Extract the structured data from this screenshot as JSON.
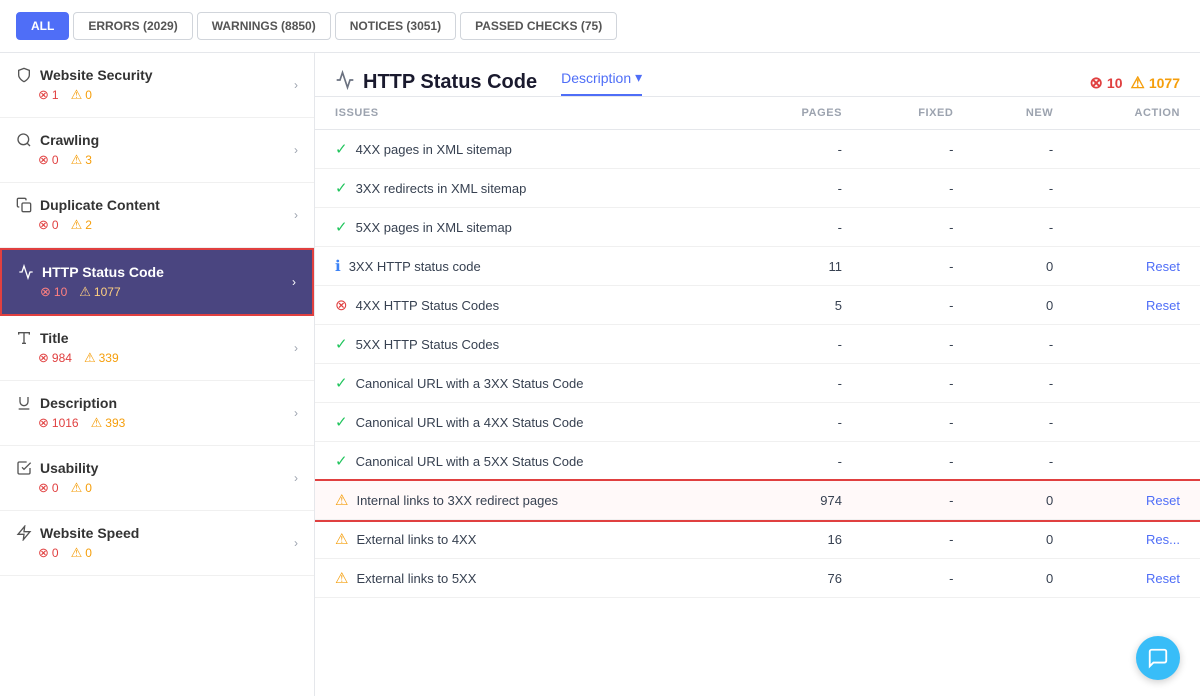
{
  "filterBar": {
    "buttons": [
      {
        "id": "all",
        "label": "ALL",
        "active": true
      },
      {
        "id": "errors",
        "label": "ERRORS (2029)",
        "active": false
      },
      {
        "id": "warnings",
        "label": "WARNINGS (8850)",
        "active": false
      },
      {
        "id": "notices",
        "label": "NOTICES (3051)",
        "active": false
      },
      {
        "id": "passed",
        "label": "PASSED CHECKS (75)",
        "active": false
      }
    ]
  },
  "sidebar": {
    "items": [
      {
        "id": "website-security",
        "icon": "shield",
        "label": "Website Security",
        "errorCount": 1,
        "warningCount": 0,
        "active": false
      },
      {
        "id": "crawling",
        "icon": "search",
        "label": "Crawling",
        "errorCount": 0,
        "warningCount": 3,
        "active": false
      },
      {
        "id": "duplicate-content",
        "icon": "copy",
        "label": "Duplicate Content",
        "errorCount": 0,
        "warningCount": 2,
        "active": false
      },
      {
        "id": "http-status-code",
        "icon": "activity",
        "label": "HTTP Status Code",
        "errorCount": 10,
        "warningCount": 1077,
        "active": true
      },
      {
        "id": "title",
        "icon": "text",
        "label": "Title",
        "errorCount": 984,
        "warningCount": 339,
        "active": false
      },
      {
        "id": "description",
        "icon": "underline",
        "label": "Description",
        "errorCount": 1016,
        "warningCount": 393,
        "active": false
      },
      {
        "id": "usability",
        "icon": "check-square",
        "label": "Usability",
        "errorCount": 0,
        "warningCount": 0,
        "active": false
      },
      {
        "id": "website-speed",
        "icon": "speed",
        "label": "Website Speed",
        "errorCount": 0,
        "warningCount": 0,
        "active": false
      }
    ]
  },
  "content": {
    "title": "HTTP Status Code",
    "descriptionButton": "Description",
    "errorCount": 10,
    "warningCount": 1077,
    "tableHeaders": {
      "issues": "ISSUES",
      "pages": "PAGES",
      "fixed": "FIXED",
      "new": "NEW",
      "action": "ACTION"
    },
    "rows": [
      {
        "id": "4xx-sitemap",
        "status": "check",
        "label": "4XX pages in XML sitemap",
        "pages": "-",
        "fixed": "-",
        "new": "-",
        "action": "",
        "highlighted": false
      },
      {
        "id": "3xx-sitemap",
        "status": "check",
        "label": "3XX redirects in XML sitemap",
        "pages": "-",
        "fixed": "-",
        "new": "-",
        "action": "",
        "highlighted": false
      },
      {
        "id": "5xx-sitemap",
        "status": "check",
        "label": "5XX pages in XML sitemap",
        "pages": "-",
        "fixed": "-",
        "new": "-",
        "action": "",
        "highlighted": false
      },
      {
        "id": "3xx-http",
        "status": "info",
        "label": "3XX HTTP status code",
        "pages": "11",
        "fixed": "-",
        "new": "0",
        "action": "Reset",
        "highlighted": false
      },
      {
        "id": "4xx-http",
        "status": "error",
        "label": "4XX HTTP Status Codes",
        "pages": "5",
        "fixed": "-",
        "new": "0",
        "action": "Reset",
        "highlighted": false
      },
      {
        "id": "5xx-http",
        "status": "check",
        "label": "5XX HTTP Status Codes",
        "pages": "-",
        "fixed": "-",
        "new": "-",
        "action": "",
        "highlighted": false
      },
      {
        "id": "canonical-3xx",
        "status": "check",
        "label": "Canonical URL with a 3XX Status Code",
        "pages": "-",
        "fixed": "-",
        "new": "-",
        "action": "",
        "highlighted": false
      },
      {
        "id": "canonical-4xx",
        "status": "check",
        "label": "Canonical URL with a 4XX Status Code",
        "pages": "-",
        "fixed": "-",
        "new": "-",
        "action": "",
        "highlighted": false
      },
      {
        "id": "canonical-5xx",
        "status": "check",
        "label": "Canonical URL with a 5XX Status Code",
        "pages": "-",
        "fixed": "-",
        "new": "-",
        "action": "",
        "highlighted": false
      },
      {
        "id": "internal-3xx",
        "status": "warning",
        "label": "Internal links to 3XX redirect pages",
        "pages": "974",
        "fixed": "-",
        "new": "0",
        "action": "Reset",
        "highlighted": true
      },
      {
        "id": "external-4xx",
        "status": "warning",
        "label": "External links to 4XX",
        "pages": "16",
        "fixed": "-",
        "new": "0",
        "action": "Res...",
        "highlighted": false
      },
      {
        "id": "external-5xx",
        "status": "warning",
        "label": "External links to 5XX",
        "pages": "76",
        "fixed": "-",
        "new": "0",
        "action": "Reset",
        "highlighted": false
      }
    ]
  }
}
